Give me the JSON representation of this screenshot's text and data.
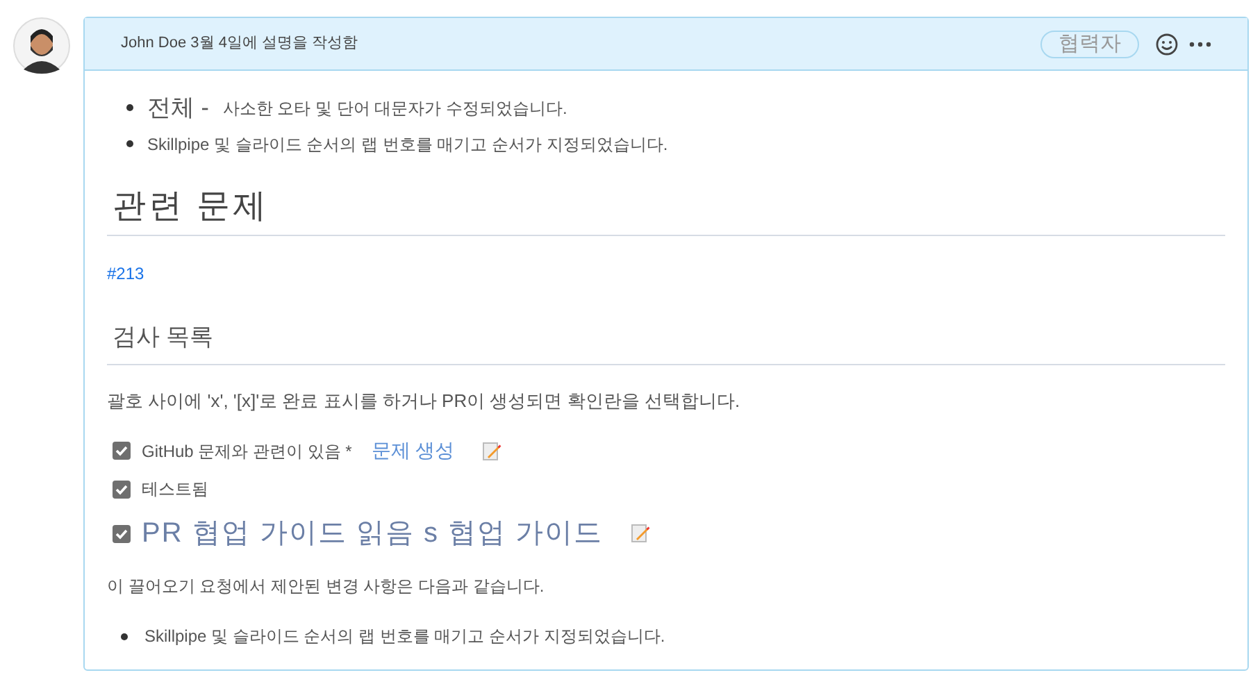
{
  "comment": {
    "header": "John Doe 3월 4일에 설명을 작성함",
    "role_badge": "협력자",
    "summary": [
      {
        "lead": "전체 -",
        "text": "사소한 오타 및 단어 대문자가 수정되었습니다."
      },
      {
        "text": "Skillpipe 및 슬라이드 순서의 랩 번호를 매기고 순서가 지정되었습니다."
      }
    ],
    "related_heading": "관련 문제",
    "issue_link": "#213",
    "checklist_heading": "검사 목록",
    "checklist_intro": "괄호 사이에 'x', '[x]'로 완료 표시를 하거나 PR이 생성되면 확인란을 선택합니다.",
    "checklist": [
      {
        "kind": "normal",
        "checked": true,
        "label": "GitHub 문제와 관련이 있음 *",
        "link": "문제 생성",
        "edit_icon": true
      },
      {
        "kind": "normal",
        "checked": true,
        "label": "테스트됨",
        "edit_icon": false
      },
      {
        "kind": "large",
        "checked": true,
        "label": "PR 협업 가이드 읽음 s 협업 가이드",
        "edit_icon": true
      }
    ],
    "changes_intro": "이 끌어오기 요청에서 제안된 변경 사항은 다음과 같습니다.",
    "changes": [
      "Skillpipe 및 슬라이드 순서의 랩 번호를 매기고 순서가 지정되었습니다."
    ]
  }
}
